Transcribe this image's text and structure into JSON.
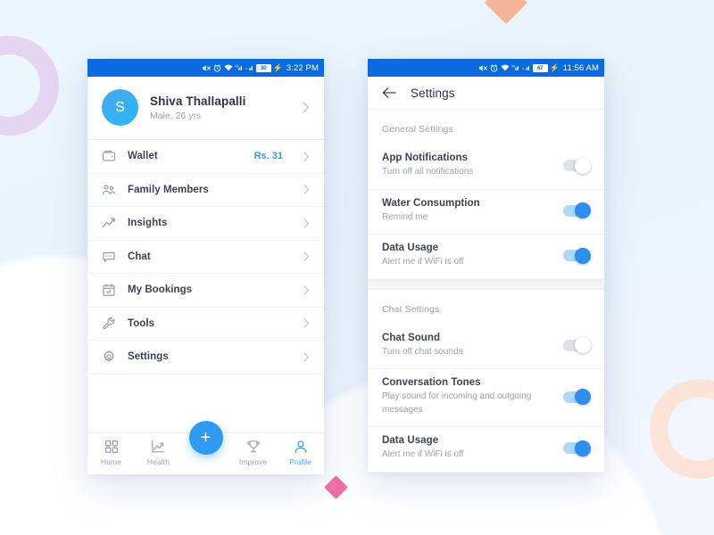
{
  "background": {
    "page_bg": "#eaf4fc",
    "ring_purple": "#e6d4f3",
    "ring_peach": "#fbe3d8",
    "diamond_peach": "#f3b497",
    "diamond_pink": "#f46fa3"
  },
  "accent": {
    "statusbar_blue": "#0a6be0",
    "primary_blue": "#3b9ef5",
    "toggle_on_track": "#aed9fb",
    "toggle_on_knob": "#2e8eeb",
    "toggle_off_track": "#dfe2e7"
  },
  "profile_screen": {
    "statusbar": {
      "icons": [
        "mute-icon",
        "alarm-icon",
        "wifi-icon",
        "signal-4g-icon",
        "signal-icon"
      ],
      "battery": "30",
      "charging": "⚡",
      "time": "3:22 PM"
    },
    "header": {
      "avatar_initial": "S",
      "name": "Shiva Thallapalli",
      "subtitle": "Male, 26 yrs"
    },
    "menu": [
      {
        "icon": "wallet-icon",
        "label": "Wallet",
        "value": "Rs. 31"
      },
      {
        "icon": "people-icon",
        "label": "Family Members",
        "value": ""
      },
      {
        "icon": "insights-icon",
        "label": "Insights",
        "value": ""
      },
      {
        "icon": "chat-icon",
        "label": "Chat",
        "value": ""
      },
      {
        "icon": "calendar-icon",
        "label": "My Bookings",
        "value": ""
      },
      {
        "icon": "wrench-icon",
        "label": "Tools",
        "value": ""
      },
      {
        "icon": "gear-icon",
        "label": "Settings",
        "value": ""
      }
    ],
    "tabbar": {
      "fab_label": "+",
      "tabs": [
        {
          "icon": "grid-icon",
          "label": "Home",
          "active": false
        },
        {
          "icon": "health-icon",
          "label": "Health",
          "active": false
        },
        {
          "icon": "trophy-icon",
          "label": "Improve",
          "active": false
        },
        {
          "icon": "person-icon",
          "label": "Profile",
          "active": true
        }
      ]
    }
  },
  "settings_screen": {
    "statusbar": {
      "battery": "47",
      "charging": "⚡",
      "time": "11:56 AM"
    },
    "appbar": {
      "back_icon": "back-arrow-icon",
      "title": "Settings"
    },
    "sections": [
      {
        "title": "General Settings",
        "rows": [
          {
            "title": "App Notifications",
            "subtitle": "Turn off all notifications",
            "state": "off"
          },
          {
            "title": "Water Consumption",
            "subtitle": "Remind me",
            "state": "on"
          },
          {
            "title": "Data Usage",
            "subtitle": "Alert me if WiFi is off",
            "state": "on"
          }
        ]
      },
      {
        "title": "Chat Settings",
        "rows": [
          {
            "title": "Chat Sound",
            "subtitle": "Turn off chat sounds",
            "state": "off"
          },
          {
            "title": "Conversation Tones",
            "subtitle": "Play sound for incoming and outgoing messages",
            "state": "on"
          },
          {
            "title": "Data Usage",
            "subtitle": "Alert me if WiFi is off",
            "state": "on"
          }
        ]
      }
    ]
  }
}
